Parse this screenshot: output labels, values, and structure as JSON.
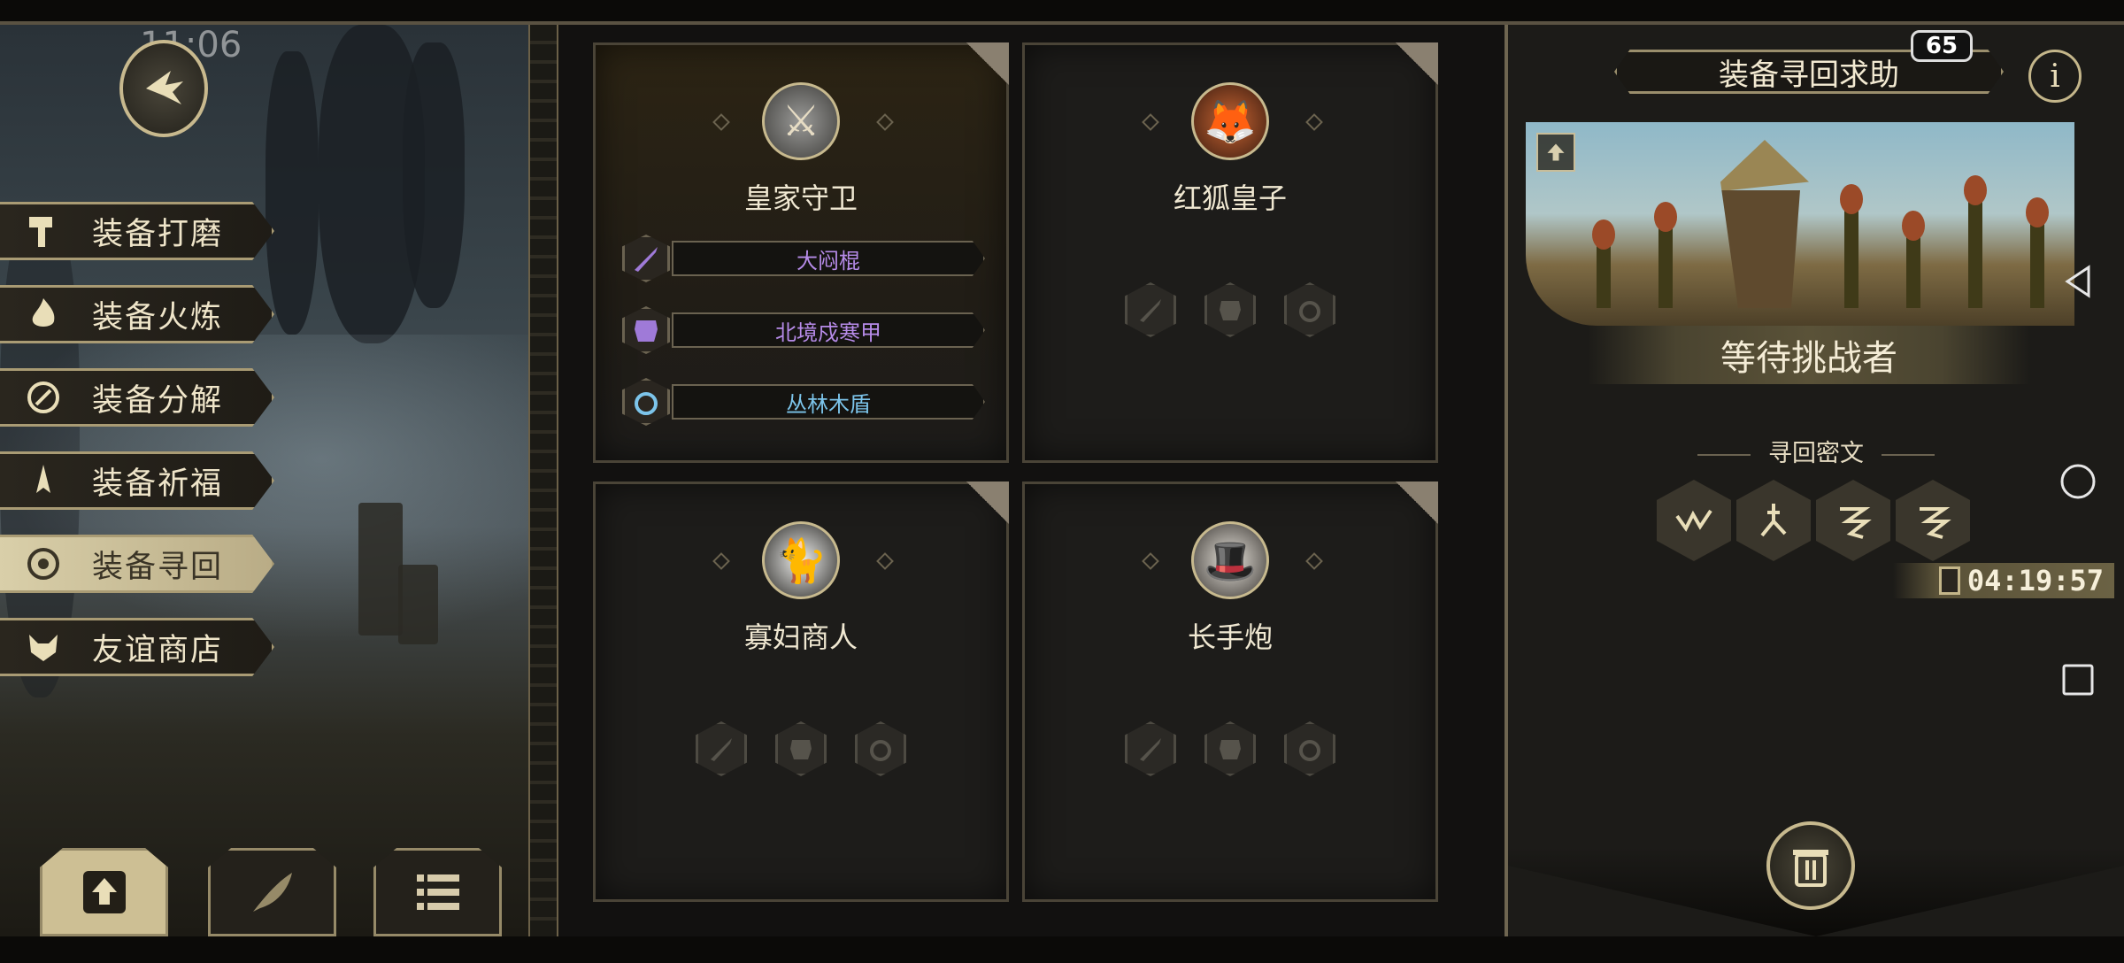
{
  "status_bar": {
    "time": "11:06"
  },
  "side_menu": {
    "items": [
      {
        "label": "装备打磨",
        "icon": "hammer-icon",
        "active": false
      },
      {
        "label": "装备火炼",
        "icon": "flame-icon",
        "active": false
      },
      {
        "label": "装备分解",
        "icon": "decompose-icon",
        "active": false
      },
      {
        "label": "装备祈福",
        "icon": "pray-icon",
        "active": false
      },
      {
        "label": "装备寻回",
        "icon": "retrieve-icon",
        "active": true
      },
      {
        "label": "友谊商店",
        "icon": "fox-icon",
        "active": false
      }
    ]
  },
  "bottom_buttons": [
    {
      "icon": "upload-icon",
      "active": true
    },
    {
      "icon": "feather-icon",
      "active": false
    },
    {
      "icon": "list-icon",
      "active": false
    }
  ],
  "characters": [
    {
      "name": "皇家守卫",
      "avatar": "knight-avatar",
      "equipment": [
        {
          "slot": "weapon",
          "name": "大闷棍",
          "color": "#b68be8"
        },
        {
          "slot": "armor",
          "name": "北境戍寒甲",
          "color": "#b68be8"
        },
        {
          "slot": "accessory",
          "name": "丛林木盾",
          "color": "#7cc4ea"
        }
      ]
    },
    {
      "name": "红狐皇子",
      "avatar": "fox-avatar",
      "equipment": []
    },
    {
      "name": "寡妇商人",
      "avatar": "widow-avatar",
      "equipment": []
    },
    {
      "name": "长手炮",
      "avatar": "gunner-avatar",
      "equipment": []
    }
  ],
  "right_panel": {
    "title": "装备寻回求助",
    "badge": "65",
    "info_label": "i",
    "status": "等待挑战者",
    "cipher_label": "寻回密文",
    "cipher_glyphs": [
      "rune-1-icon",
      "rune-2-icon",
      "rune-3-icon",
      "rune-4-icon"
    ],
    "timer": "04:19:57"
  },
  "colors": {
    "accent": "#c7b98e",
    "epic": "#b68be8",
    "rare": "#7cc4ea"
  }
}
